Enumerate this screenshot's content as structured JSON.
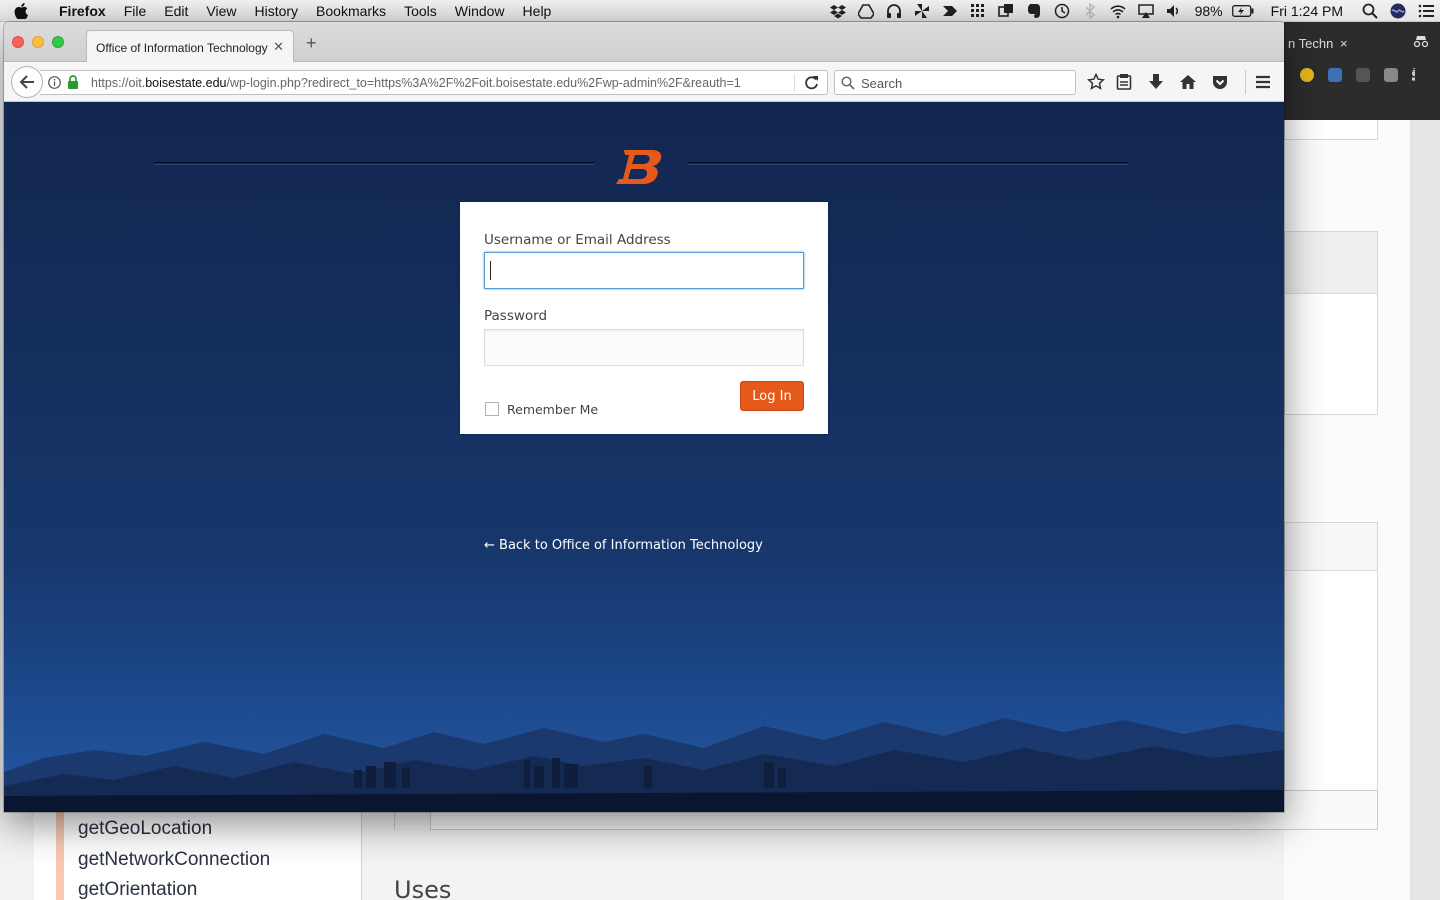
{
  "menubar": {
    "app": "Firefox",
    "items": [
      "File",
      "Edit",
      "View",
      "History",
      "Bookmarks",
      "Tools",
      "Window",
      "Help"
    ],
    "battery": "98%",
    "clock": "Fri 1:24 PM"
  },
  "browser": {
    "tab_title": "Office of Information Technology",
    "url_prefix": "https://oit.",
    "url_domain": "boisestate.edu",
    "url_path": "/wp-login.php?redirect_to=https%3A%2F%2Foit.boisestate.edu%2Fwp-admin%2F&reauth=1",
    "search_placeholder": "Search"
  },
  "login": {
    "username_label": "Username or Email Address",
    "username_value": "",
    "password_label": "Password",
    "password_value": "",
    "remember_label": "Remember Me",
    "remember_checked": false,
    "submit_label": "Log In",
    "back_link": "← Back to Office of Information Technology"
  },
  "background_window": {
    "tab_fragment": "n Techn",
    "sidebar_links": [
      "getGeoLocation",
      "getNetworkConnection",
      "getOrientation"
    ],
    "section_heading": "Uses"
  },
  "colors": {
    "accent_orange": "#e55a1b",
    "page_navy": "#12264f"
  }
}
